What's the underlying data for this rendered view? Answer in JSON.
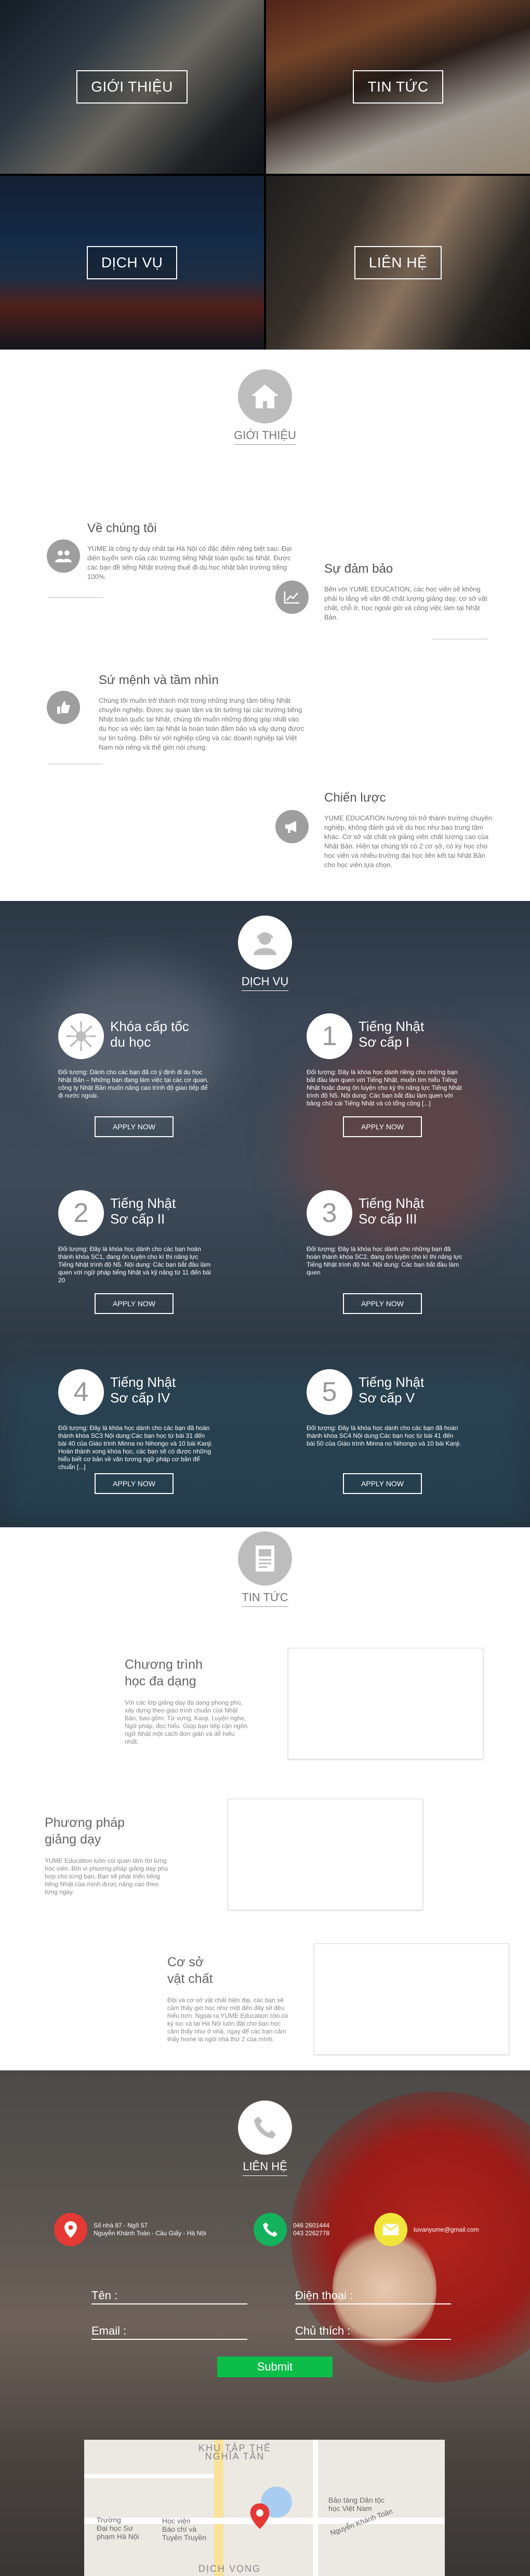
{
  "hero": {
    "tiles": [
      {
        "label": "GIỚI THIỆU"
      },
      {
        "label": "TIN TỨC"
      },
      {
        "label": "DỊCH VỤ"
      },
      {
        "label": "LIÊN HỆ"
      }
    ]
  },
  "about": {
    "title": "GIỚI THIỆU",
    "items": [
      {
        "title": "Về chúng tôi",
        "text": "YUME là công ty duy nhất tại Hà Nội có đặc điểm riêng biệt sau: Đại diện tuyển sinh của các trường tiếng Nhật toàn quốc tại Nhật. Được các bạn đề tiếng Nhật trường thuê đi du học nhật bản trường tiếng 100%."
      },
      {
        "title": "Sự đảm bảo",
        "text": "Bên với YUME EDUCATION, các học viên sẽ không phải lo lắng về vấn đề chất lượng giảng dạy, cơ sở vật chất, chỗ ở, học ngoài giờ và công việc làm tại Nhật Bản."
      },
      {
        "title": "Sứ mệnh và tầm nhìn",
        "text": "Chúng tôi muốn trở thành một trong những trung tâm tiếng Nhật chuyên nghiệp. Được sự quan tâm và tin tưởng tại các trường tiếng Nhật toàn quốc tại Nhật, chúng tôi muốn những đóng góp nhất vào du học và việc làm tại Nhật là hoàn toàn đảm bảo và xây dựng được sự tin tưởng. Đến từ với nghiệp cũng và các doanh nghiệp tại Việt Nam nói riêng và thế giới nói chung."
      },
      {
        "title": "Chiến lược",
        "text": "YUME EDUCATION hướng tới trở thành trường chuyên nghiệp, không đánh giá về du học như bao trung tâm khác. Cơ sở vật chất và giảng viên chất lượng cao của Nhật Bản. Hiện tại chúng tôi có 2 cơ sở, có kỳ học cho học viên và nhiều trường đại học liên kết tại Nhật Bản cho học viên lựa chọn."
      }
    ]
  },
  "services": {
    "title": "DỊCH VỤ",
    "apply_label": "APPLY NOW",
    "items": [
      {
        "badge": "",
        "title_l1": "Khóa cấp tốc",
        "title_l2": "du học",
        "text": "Đối tượng: Dành cho các bạn đã có ý định đi du học Nhật Bản – Những bạn đang làm việc tại các cơ quan, công ty Nhật Bản muốn nâng cao trình độ giao tiếp để đi nước ngoài."
      },
      {
        "badge": "1",
        "title_l1": "Tiếng Nhật",
        "title_l2": "Sơ cấp I",
        "text": "Đối tượng: Đây là khóa học dành riêng cho những bạn bắt đầu làm quen với Tiếng Nhật, muốn tìm hiểu Tiếng Nhật hoặc đang ôn luyện cho kỳ thi năng lực Tiếng Nhật trình độ N5. Nội dung: Các bạn bắt đầu làm quen với bảng chữ cái Tiếng Nhật và có tổng cộng [...]"
      },
      {
        "badge": "2",
        "title_l1": "Tiếng Nhật",
        "title_l2": "Sơ cấp II",
        "text": "Đối tượng: Đây là khóa học dành cho các bạn hoàn thành khóa SC1, đang ôn luyện cho kì thi năng lực Tiếng Nhật trình độ N5. Nội dung: Các bạn bắt đầu làm quen với ngữ pháp tiếng Nhật và kỹ năng từ 11 đến bài 20"
      },
      {
        "badge": "3",
        "title_l1": "Tiếng Nhật",
        "title_l2": "Sơ cấp III",
        "text": "Đối tượng: Đây là khóa học dành cho những bạn đã hoàn thành khóa SC2, đang ôn luyện cho kì thi năng lực Tiếng Nhật trình độ N4. Nội dung: Các bạn bắt đầu làm quen"
      },
      {
        "badge": "4",
        "title_l1": "Tiếng Nhật",
        "title_l2": "Sơ cấp IV",
        "text": "Đối tượng: Đây là khóa học dành cho các bạn đã hoàn thành khóa SC3 Nội dung:Các bạn học từ bài 31 đến bài 40 của Giáo trình Minna no Nihongo và 10 bài Kanji. Hoàn thành xong khóa học, các bạn sẽ có được những hiểu biết cơ bản về văn tương ngữ pháp cơ bản để chuẩn [...]"
      },
      {
        "badge": "5",
        "title_l1": "Tiếng Nhật",
        "title_l2": "Sơ cấp V",
        "text": "Đối tượng: Đây là khóa học dành cho các bạn đã hoàn thành khóa SC4 Nội dung:Các bạn học từ bài 41 đến bài 50 của Giáo trình Minna no Nihongo và 10 bài Kanji."
      }
    ]
  },
  "news": {
    "title": "TIN TỨC",
    "items": [
      {
        "title_l1": "Chương trình",
        "title_l2": "học đa dạng",
        "text": "Với các lớp giảng dạy đa dạng phong phú, xây dựng theo giáo trình chuẩn của Nhật Bản, bao gồm: Từ vựng, Kanji, Luyện nghe, Ngữ pháp, đọc hiểu. Giúp bạn tiếp cận ngôn ngữ Nhật một cách đơn giản và dễ hiểu nhất."
      },
      {
        "title_l1": "Phương pháp",
        "title_l2": "giảng dạy",
        "text": "YUME Education luôn coi quan tâm tới từng học viên. Bởi vì phương pháp giảng dạy phù hợp cho từng bạn, Bạn sẽ phát triển tiếng tiếng Nhật của mình được nâng cao theo từng ngày."
      },
      {
        "title_l1": "Cơ sở",
        "title_l2": "vật chất",
        "text": "Đội và cơ sở vật chất hiện đại, các bạn sẽ cảm thấy giờ học như một đến đây sẽ đều hiểu hơn. Ngoài ra YUME Education còn có ký túc xá tại Hà Nội luôn đặt cho bạn học cảm thấy như ở nhà, ngay để các bạn cảm thấy home là ngôi nhà thứ 2 của mình."
      }
    ]
  },
  "contact": {
    "title": "LIÊN HỆ",
    "address_l1": "Số nhà 87 - Ngõ 57",
    "address_l2": "Nguyễn Khánh Toàn - Cầu Giấy - Hà Nội",
    "phone_l1": "046 2601444",
    "phone_l2": "043 2262778",
    "email": "tuvanyume@gmail.com",
    "name_label": "Tên :",
    "phone_label": "Điện thoại :",
    "email_label": "Email :",
    "subject_label": "Chủ thích :",
    "submit_label": "Submit",
    "map": {
      "district": "KHU TẬP THỂ\nNGHĨA TÂN",
      "school": "Trường\nĐại học Sư\nphạm Hà Nội",
      "academy": "Học viện\nBáo chí và\nTuyên Truyền",
      "museum": "Bảo tàng Dân tộc\nhọc Việt Nam",
      "road1": "Nguyễn Khánh Toàn",
      "road2": "DỊCH VỌNG"
    }
  },
  "colors": {
    "accent_green": "#0dbd4a",
    "pin_red": "#e53935",
    "phone_green": "#14b25c",
    "mail_yellow": "#f2e53a",
    "icon_gray": "#bdbdbd"
  }
}
